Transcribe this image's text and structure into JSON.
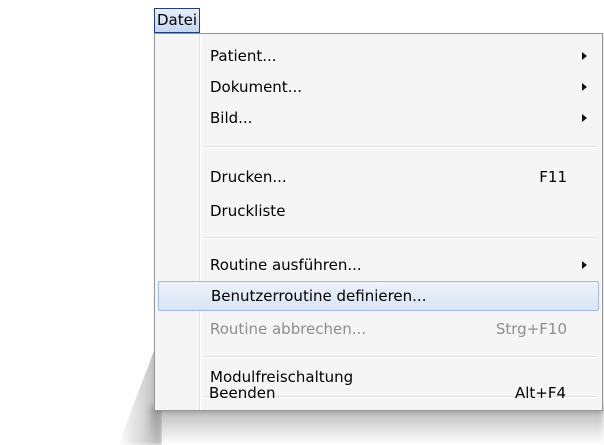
{
  "menubar": {
    "datei_label": "Datei"
  },
  "menu": {
    "items": [
      {
        "label": "Patient...",
        "shortcut": "",
        "submenu": true
      },
      {
        "label": "Dokument...",
        "shortcut": "",
        "submenu": true
      },
      {
        "label": "Bild...",
        "shortcut": "",
        "submenu": true
      },
      {
        "label": "Drucken...",
        "shortcut": "F11",
        "submenu": false
      },
      {
        "label": "Druckliste",
        "shortcut": "",
        "submenu": false
      },
      {
        "label": "Routine ausführen...",
        "shortcut": "",
        "submenu": true
      },
      {
        "label": "Benutzerroutine definieren...",
        "shortcut": "",
        "submenu": false,
        "highlighted": true
      },
      {
        "label": "Routine abbrechen...",
        "shortcut": "Strg+F10",
        "submenu": false,
        "disabled": true
      },
      {
        "label": "Modulfreischaltung",
        "shortcut": "",
        "submenu": false
      },
      {
        "label": "Beenden",
        "shortcut": "Alt+F4",
        "submenu": false
      }
    ]
  },
  "colors": {
    "highlight_bg": "#d9e4f5",
    "highlight_border": "#9fb8de",
    "disabled_text": "#8d8d8d",
    "menubar_border": "#1f3f7a"
  }
}
